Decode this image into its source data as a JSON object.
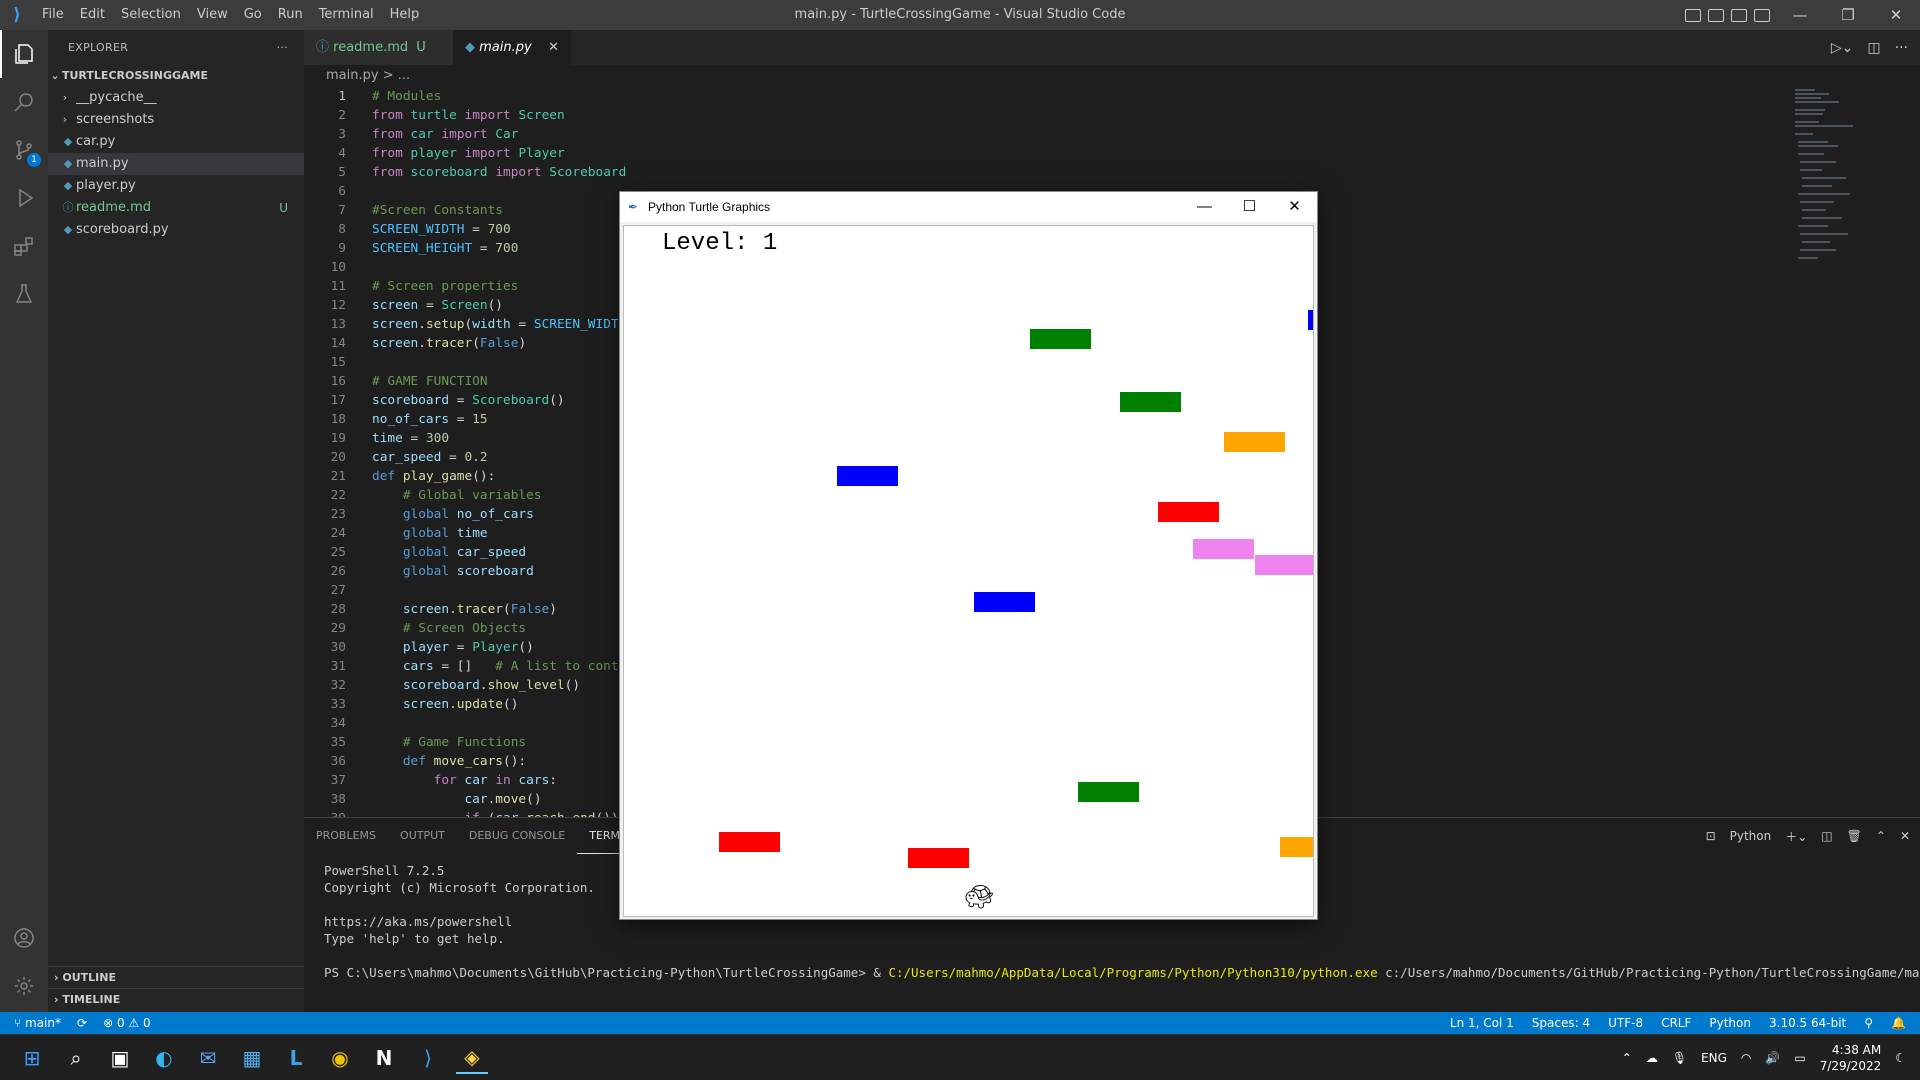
{
  "window": {
    "title": "main.py - TurtleCrossingGame - Visual Studio Code"
  },
  "menu": [
    "File",
    "Edit",
    "Selection",
    "View",
    "Go",
    "Run",
    "Terminal",
    "Help"
  ],
  "explorer": {
    "header": "EXPLORER",
    "root": "TURTLECROSSINGGAME",
    "items": [
      {
        "label": "__pycache__",
        "type": "folder"
      },
      {
        "label": "screenshots",
        "type": "folder"
      },
      {
        "label": "car.py",
        "type": "py"
      },
      {
        "label": "main.py",
        "type": "py"
      },
      {
        "label": "player.py",
        "type": "py"
      },
      {
        "label": "readme.md",
        "type": "md",
        "git": "U"
      },
      {
        "label": "scoreboard.py",
        "type": "py"
      }
    ],
    "outline": "OUTLINE",
    "timeline": "TIMELINE"
  },
  "tabs": [
    {
      "label": "readme.md",
      "git": "U"
    },
    {
      "label": "main.py"
    }
  ],
  "breadcrumb": "main.py > ...",
  "code": {
    "lines": [
      "1",
      "2",
      "3",
      "4",
      "5",
      "6",
      "7",
      "8",
      "9",
      "10",
      "11",
      "12",
      "13",
      "14",
      "15",
      "16",
      "17",
      "18",
      "19",
      "20",
      "21",
      "22",
      "23",
      "24",
      "25",
      "26",
      "27",
      "28",
      "29",
      "30",
      "31",
      "32",
      "33",
      "34",
      "35",
      "36",
      "37",
      "38",
      "39"
    ]
  },
  "panel": {
    "tabs": [
      "PROBLEMS",
      "OUTPUT",
      "DEBUG CONSOLE",
      "TERMINAL"
    ],
    "shell": "Python",
    "terminal": [
      "PowerShell 7.2.5",
      "Copyright (c) Microsoft Corporation.",
      "",
      "https://aka.ms/powershell",
      "Type 'help' to get help.",
      ""
    ],
    "prompt": "PS C:\\Users\\mahmo\\Documents\\GitHub\\Practicing-Python\\TurtleCrossingGame> & ",
    "exe": "C:/Users/mahmo/AppData/Local/Programs/Python/Python310/python.exe",
    "arg": " c:/Users/mahmo/Documents/GitHub/Practicing-Python/TurtleCrossingGame/main.py"
  },
  "status": {
    "branch": "main*",
    "errors": "0",
    "warnings": "0",
    "position": "Ln 1, Col 1",
    "spaces": "Spaces: 4",
    "encoding": "UTF-8",
    "eol": "CRLF",
    "language": "Python",
    "interpreter": "3.10.5 64-bit"
  },
  "taskbar": {
    "lang": "ENG",
    "time": "4:38 AM",
    "date": "7/29/2022"
  },
  "turtle_window": {
    "title": "Python Turtle Graphics",
    "level_text": "Level: 1",
    "cars": [
      {
        "color": "#008000"
      },
      {
        "color": "#0000ff"
      },
      {
        "color": "#008000"
      },
      {
        "color": "#ffa500"
      },
      {
        "color": "#0000ff"
      },
      {
        "color": "#ff0000"
      },
      {
        "color": "#ee82ee"
      },
      {
        "color": "#ee82ee"
      },
      {
        "color": "#0000ff"
      },
      {
        "color": "#008000"
      },
      {
        "color": "#ff0000"
      },
      {
        "color": "#ff0000"
      },
      {
        "color": "#ffa500"
      }
    ]
  },
  "colors": {
    "accent": "#007acc",
    "sidebar": "#252526",
    "editor": "#1e1e1e"
  }
}
